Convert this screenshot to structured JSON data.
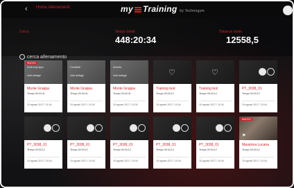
{
  "header": {
    "back_icon": "chevron-left-icon",
    "section_label": "Home Allenamenti",
    "logo_text": "my",
    "logo_text2": "Training",
    "logo_sub": "by Technogym",
    "profile_icon": "user-avatar-icon"
  },
  "stats": {
    "search_label": "Cerca",
    "search_placeholder": "cerca allenamento",
    "time_label": "Tempo totale",
    "time_value": "448:20:34",
    "distance_label": "Distanza totale",
    "distance_value": "12558,5"
  },
  "menu": {
    "send": "Invia al gruppo",
    "share": "Condividi",
    "unlink": "Annulla",
    "details": "Vedi dettagli"
  },
  "cards": [
    {
      "tag": "NUOVO",
      "title": "Monte Grappa",
      "sub": "Tempo 00:03:41",
      "date": "15 agosto 2017 / 11:04",
      "style": "menu"
    },
    {
      "tag": "",
      "title": "Monte Grappa",
      "sub": "Tempo 00:03:41",
      "date": "15 agosto 2017 / 11:04",
      "style": "menu"
    },
    {
      "tag": "",
      "title": "Monte Grappa",
      "sub": "Tempo 00:03:41",
      "date": "15 agosto 2017 / 11:04",
      "style": "menu"
    },
    {
      "tag": "",
      "title": "Training test",
      "sub": "Tempo 00:03:12",
      "date": "15 agosto 2017 / 11:04",
      "style": "heart"
    },
    {
      "tag": "",
      "title": "Training test",
      "sub": "Tempo 00:03:12",
      "date": "15 agosto 2017 / 11:04",
      "style": "heart"
    },
    {
      "tag": "",
      "title": "PT_3038_01",
      "sub": "Tempo 00:03:12",
      "date": "15 agosto 2017 / 10:44",
      "style": "icons"
    },
    {
      "tag": "",
      "title": "PT_3038_01",
      "sub": "Tempo 00:03:12",
      "date": "15 agosto 2017 / 10:44",
      "style": "icons"
    },
    {
      "tag": "",
      "title": "PT_3038_01",
      "sub": "Tempo 00:03:12",
      "date": "15 agosto 2017 / 10:44",
      "style": "icons"
    },
    {
      "tag": "",
      "title": "PT_3038_01",
      "sub": "Tempo 00:03:12",
      "date": "15 agosto 2017 / 10:44",
      "style": "icons"
    },
    {
      "tag": "",
      "title": "PT_3038_01",
      "sub": "Tempo 00:03:12",
      "date": "15 agosto 2017 / 10:44",
      "style": "icons"
    },
    {
      "tag": "",
      "title": "PT_3038_01",
      "sub": "Tempo 00:03:12",
      "date": "15 agosto 2017 / 10:44",
      "style": "icons"
    },
    {
      "tag": "NUOVO",
      "title": "Maratona Lucana",
      "sub": "Tempo 00:03:12",
      "date": "15 agosto 2017 / 10:44",
      "style": "photo"
    }
  ],
  "colors": {
    "accent": "#d21f25",
    "background": "#121214",
    "card": "#ffffff"
  }
}
